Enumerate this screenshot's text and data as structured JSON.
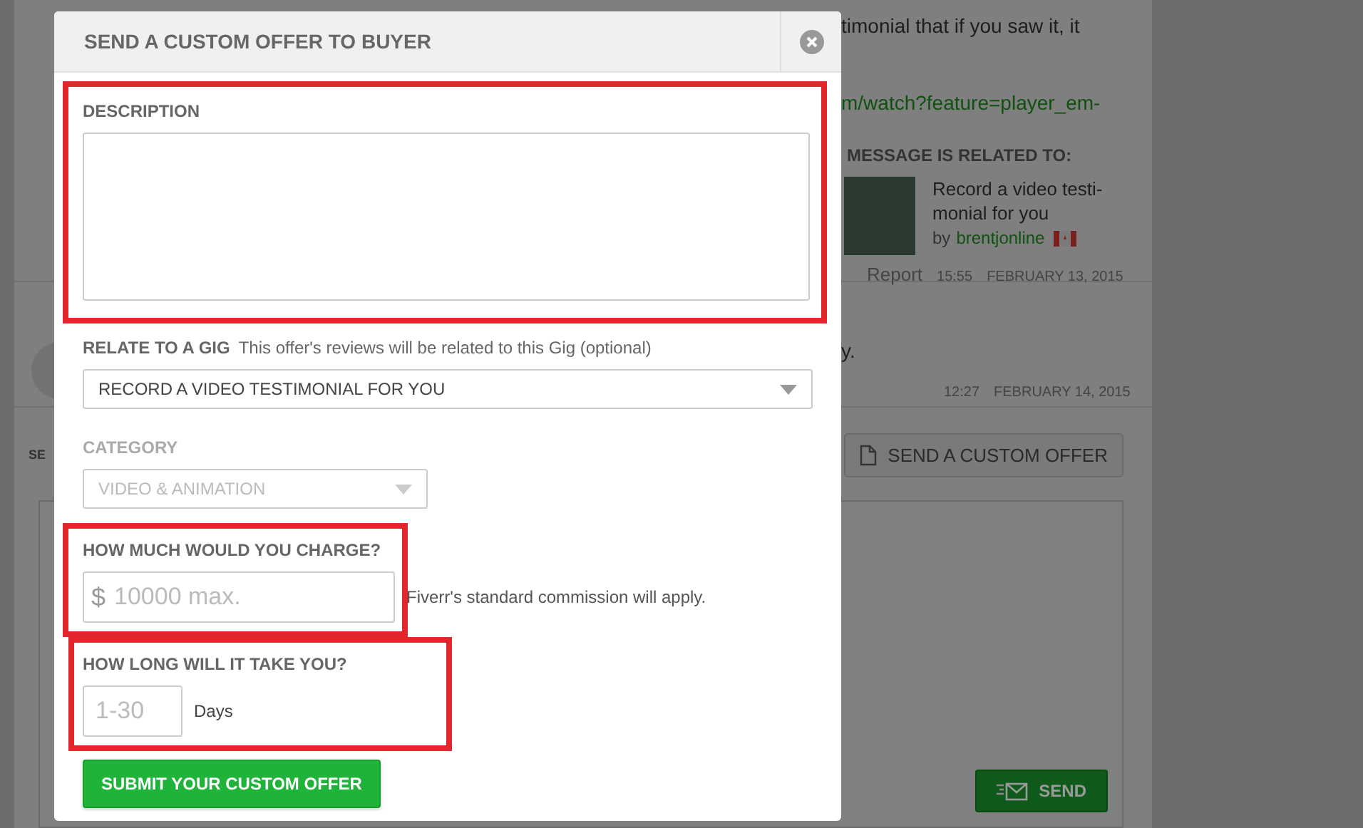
{
  "background_page": {
    "message_text": "timonial that if you saw it, it",
    "message_link": "m/watch?feature=player_em-",
    "related_heading": "MESSAGE IS RELATED TO:",
    "related_gig": {
      "title_line_1": "Record a video testi-",
      "title_line_2": "monial for you",
      "by": "by",
      "seller": "brentjonline"
    },
    "report": "Report",
    "first_time": "15:55",
    "first_date": "FEBRUARY 13, 2015",
    "second_text": "y.",
    "second_time": "12:27",
    "second_date": "FEBRUARY 14, 2015",
    "reply_label": "SE",
    "custom_offer_button": "SEND A CUSTOM OFFER",
    "send_button": "SEND"
  },
  "dialog": {
    "title": "SEND A CUSTOM OFFER TO BUYER",
    "sections": [
      {
        "kind": "textarea",
        "label": "DESCRIPTION",
        "highlighted": true
      },
      {
        "kind": "select",
        "label": "RELATE TO A GIG",
        "hint": "This offer's reviews will be related to this Gig (optional)",
        "value": "RECORD A VIDEO TESTIMONIAL FOR YOU",
        "disabled": false,
        "highlighted": false
      },
      {
        "kind": "select",
        "label": "CATEGORY",
        "value": "VIDEO & ANIMATION",
        "disabled": true,
        "highlighted": false
      },
      {
        "kind": "price",
        "label": "HOW MUCH WOULD YOU CHARGE?",
        "prefix": "$",
        "placeholder": "10000 max.",
        "note": "Fiverr's standard commission will apply.",
        "highlighted": true
      },
      {
        "kind": "days",
        "label": "HOW LONG WILL IT TAKE YOU?",
        "placeholder": "1-30",
        "unit": "Days",
        "highlighted": true
      }
    ],
    "submit": "SUBMIT YOUR CUSTOM OFFER"
  }
}
